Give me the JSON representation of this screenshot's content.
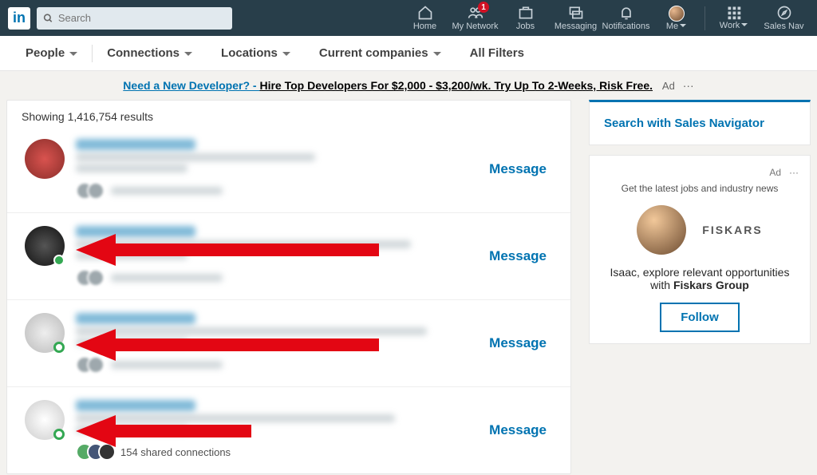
{
  "nav": {
    "logo": "in",
    "search_placeholder": "Search",
    "items": {
      "home": "Home",
      "network": "My Network",
      "jobs": "Jobs",
      "messaging": "Messaging",
      "notifications": "Notifications",
      "me": "Me",
      "work": "Work",
      "sales": "Sales Nav"
    },
    "network_badge": "1"
  },
  "filters": {
    "people": "People",
    "connections": "Connections",
    "locations": "Locations",
    "companies": "Current companies",
    "all": "All Filters"
  },
  "ad_banner": {
    "blue": "Need a New Developer? - ",
    "black": "Hire Top Developers For $2,000 - $3,200/wk. Try Up To 2-Weeks, Risk Free.",
    "tag": "Ad",
    "dots": "···"
  },
  "results_header": "Showing 1,416,754 results",
  "message_btn": "Message",
  "shared_conn": "154 shared connections",
  "sidebar": {
    "sales_nav": "Search with Sales Navigator",
    "ad_tag": "Ad",
    "ad_dots": "···",
    "ad_sub": "Get the latest jobs and industry news",
    "brand": "FISKARS",
    "explore_1": "Isaac, explore relevant opportunities",
    "explore_2": "with ",
    "explore_3": "Fiskars Group",
    "follow": "Follow"
  }
}
